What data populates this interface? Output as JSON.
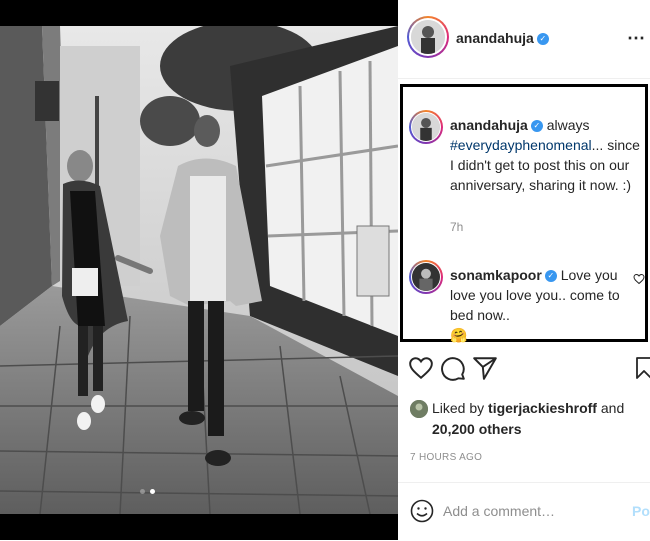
{
  "post": {
    "username": "anandahuja",
    "verified_icon": "verified-badge-icon",
    "more_icon": "ellipsis-icon"
  },
  "caption": {
    "username": "anandahuja",
    "text_lead": "always",
    "hashtag": "#everydayphenomenal",
    "text_rest": "... since I didn't get to post this on our anniversary, sharing it now. :)",
    "time": "7h"
  },
  "reply": {
    "username": "sonamkapoor",
    "text": "Love you love you love you.. come to bed now..",
    "emoji": "🤗"
  },
  "likes": {
    "prefix": "Liked by",
    "user": "tigerjackieshroff",
    "and": "and",
    "others": "20,200 others"
  },
  "timestamp": "7 HOURS AGO",
  "add_comment": {
    "placeholder": "Add a comment…",
    "post_label": "Post"
  },
  "colors": {
    "verified": "#3897f0",
    "hashtag": "#00376b",
    "muted": "#8e8e8e"
  }
}
